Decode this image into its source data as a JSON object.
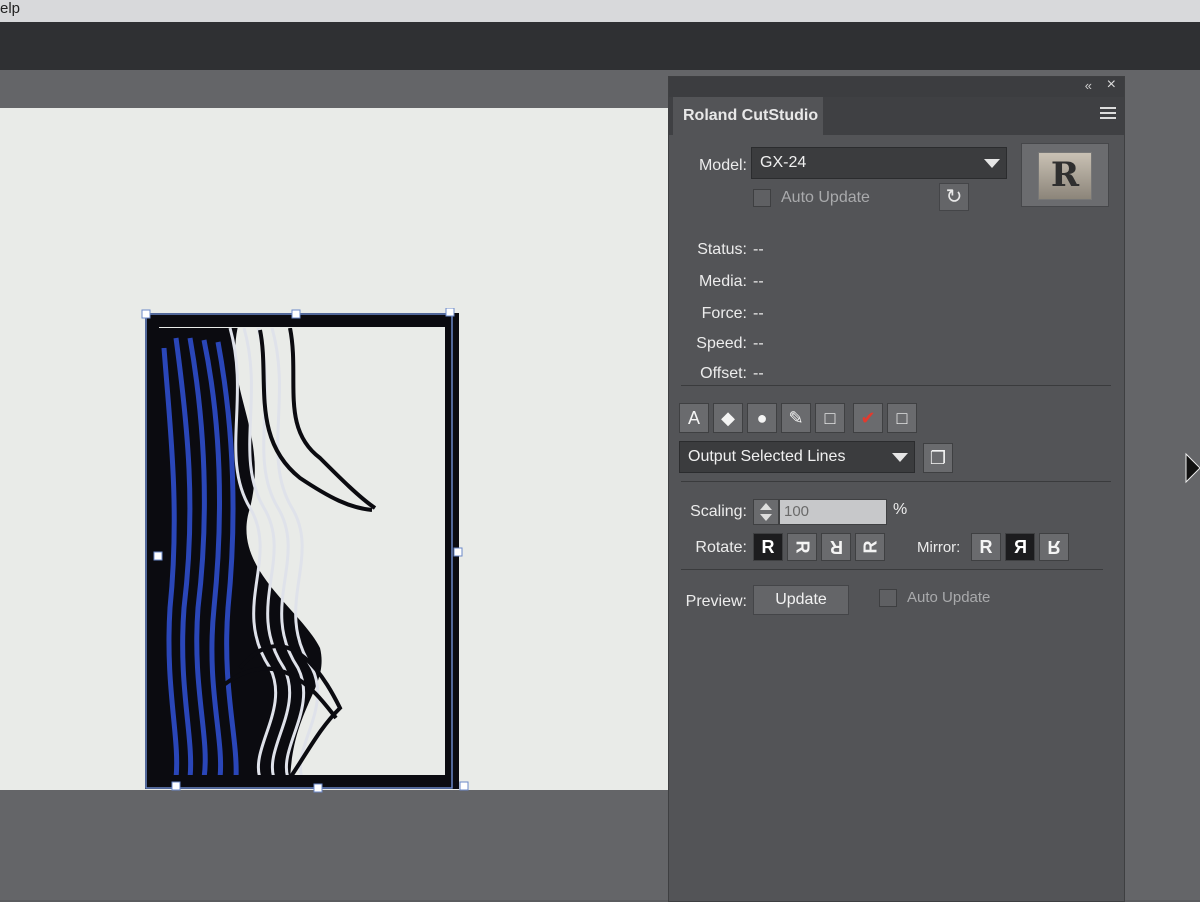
{
  "menubar": {
    "help_fragment": "elp"
  },
  "panel": {
    "tab_title": "Roland CutStudio",
    "model_label": "Model:",
    "model_value": "GX-24",
    "auto_update_label": "Auto Update",
    "status": [
      {
        "label": "Status:",
        "value": "--"
      },
      {
        "label": "Media:",
        "value": "--"
      },
      {
        "label": "Force:",
        "value": "--"
      },
      {
        "label": "Speed:",
        "value": "--"
      },
      {
        "label": "Offset:",
        "value": "--"
      }
    ],
    "output_select_value": "Output Selected Lines",
    "scaling_label": "Scaling:",
    "scaling_value": "100",
    "scaling_unit": "%",
    "rotate_label": "Rotate:",
    "rotate_options": [
      "R",
      "R",
      "R",
      "R"
    ],
    "mirror_label": "Mirror:",
    "mirror_options": [
      "R",
      "R",
      "R"
    ],
    "preview_label": "Preview:",
    "update_button": "Update",
    "preview_auto_update_label": "Auto Update",
    "logo_letter": "R"
  },
  "colors": {
    "art_blue": "#2a46b8",
    "art_black": "#0b0b10",
    "panel_bg": "#535457",
    "artboard_bg": "#e9ebe8"
  }
}
